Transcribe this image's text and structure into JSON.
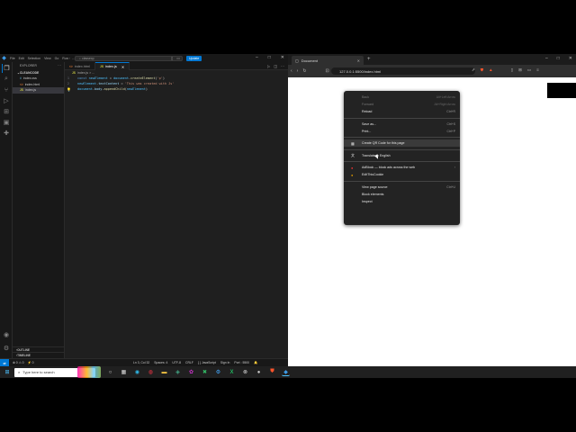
{
  "vscode": {
    "menu": [
      "File",
      "Edit",
      "Selection",
      "View",
      "Go",
      "Run",
      "..."
    ],
    "search_placeholder": "classexp",
    "update_label": "Update",
    "explorer_label": "EXPLORER",
    "folder_name": "CLEANCODE",
    "files": [
      {
        "icon": "#",
        "name": "index.css",
        "color": "#519aba"
      },
      {
        "icon": "<>",
        "name": "index.html",
        "color": "#e37933"
      },
      {
        "icon": "JS",
        "name": "index.js",
        "color": "#cbcb41"
      }
    ],
    "outline_label": "OUTLINE",
    "timeline_label": "TIMELINE",
    "tabs": [
      {
        "icon": "<>",
        "name": "index.html"
      },
      {
        "icon": "JS",
        "name": "index.js"
      }
    ],
    "breadcrumb": "index.js > ...",
    "code": {
      "l1": {
        "num": "1",
        "kw": "const",
        "var": "newElement",
        "eq": " = ",
        "obj": "document",
        "dot": ".",
        "fn": "createElement",
        "open": "(",
        "str": "'p'",
        "close": ")"
      },
      "l2": {
        "num": "2",
        "var": "newElement",
        "dot": ".",
        "prop": "textContent",
        "eq": " = ",
        "str": "'This was created with Js'"
      },
      "l3": {
        "num": "3",
        "obj": "document",
        "dot1": ".",
        "prop": "body",
        "dot2": ".",
        "fn": "appendChild",
        "open": "(",
        "var": "newElement",
        "close": ")"
      }
    },
    "status": {
      "errors": "⊗ 0 ⚠ 0",
      "ports": "⚡ 0",
      "position": "Ln 3, Col 32",
      "spaces": "Spaces: 4",
      "encoding": "UTF-8",
      "eol": "CRLF",
      "language": "{ } JavaScript",
      "sign_in": "Sign In",
      "port": "Port : 5500"
    }
  },
  "browser": {
    "tab_title": "Document",
    "url": "127.0.0.1:5500/index.html"
  },
  "context_menu": {
    "items": [
      {
        "label": "Back",
        "shortcut": "Alt+Left Arrow",
        "disabled": true
      },
      {
        "label": "Forward",
        "shortcut": "Alt+Right Arrow",
        "disabled": true
      },
      {
        "label": "Reload",
        "shortcut": "Ctrl+R"
      },
      {
        "sep": true
      },
      {
        "label": "Save as...",
        "shortcut": "Ctrl+S"
      },
      {
        "label": "Print...",
        "shortcut": "Ctrl+P"
      },
      {
        "sep": true
      },
      {
        "label": "Create QR Code for this page",
        "icon": "▦",
        "hover": true
      },
      {
        "sep": true
      },
      {
        "label": "Translate to English",
        "icon": "文"
      },
      {
        "sep": true
      },
      {
        "label": "AdBlock — block ads across the web",
        "icon": "●",
        "icon_color": "#e33",
        "submenu": true
      },
      {
        "label": "EditThisCookie",
        "icon": "●",
        "icon_color": "#d90"
      },
      {
        "sep": true
      },
      {
        "label": "View page source",
        "shortcut": "Ctrl+U"
      },
      {
        "label": "Block elements"
      },
      {
        "label": "Inspect"
      }
    ]
  },
  "taskbar": {
    "search_placeholder": "Type here to search"
  }
}
